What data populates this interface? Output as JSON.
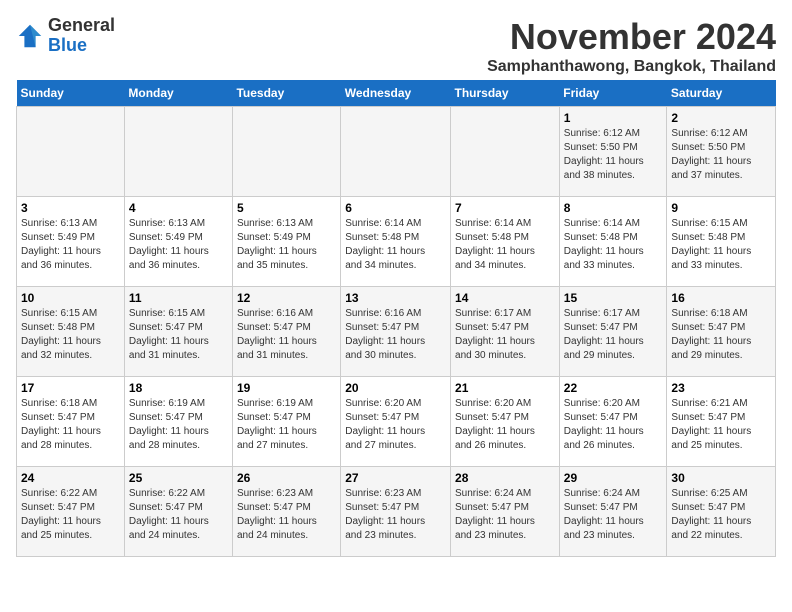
{
  "header": {
    "logo_line1": "General",
    "logo_line2": "Blue",
    "month_title": "November 2024",
    "location": "Samphanthawong, Bangkok, Thailand"
  },
  "weekdays": [
    "Sunday",
    "Monday",
    "Tuesday",
    "Wednesday",
    "Thursday",
    "Friday",
    "Saturday"
  ],
  "weeks": [
    [
      {
        "day": "",
        "info": ""
      },
      {
        "day": "",
        "info": ""
      },
      {
        "day": "",
        "info": ""
      },
      {
        "day": "",
        "info": ""
      },
      {
        "day": "",
        "info": ""
      },
      {
        "day": "1",
        "info": "Sunrise: 6:12 AM\nSunset: 5:50 PM\nDaylight: 11 hours\nand 38 minutes."
      },
      {
        "day": "2",
        "info": "Sunrise: 6:12 AM\nSunset: 5:50 PM\nDaylight: 11 hours\nand 37 minutes."
      }
    ],
    [
      {
        "day": "3",
        "info": "Sunrise: 6:13 AM\nSunset: 5:49 PM\nDaylight: 11 hours\nand 36 minutes."
      },
      {
        "day": "4",
        "info": "Sunrise: 6:13 AM\nSunset: 5:49 PM\nDaylight: 11 hours\nand 36 minutes."
      },
      {
        "day": "5",
        "info": "Sunrise: 6:13 AM\nSunset: 5:49 PM\nDaylight: 11 hours\nand 35 minutes."
      },
      {
        "day": "6",
        "info": "Sunrise: 6:14 AM\nSunset: 5:48 PM\nDaylight: 11 hours\nand 34 minutes."
      },
      {
        "day": "7",
        "info": "Sunrise: 6:14 AM\nSunset: 5:48 PM\nDaylight: 11 hours\nand 34 minutes."
      },
      {
        "day": "8",
        "info": "Sunrise: 6:14 AM\nSunset: 5:48 PM\nDaylight: 11 hours\nand 33 minutes."
      },
      {
        "day": "9",
        "info": "Sunrise: 6:15 AM\nSunset: 5:48 PM\nDaylight: 11 hours\nand 33 minutes."
      }
    ],
    [
      {
        "day": "10",
        "info": "Sunrise: 6:15 AM\nSunset: 5:48 PM\nDaylight: 11 hours\nand 32 minutes."
      },
      {
        "day": "11",
        "info": "Sunrise: 6:15 AM\nSunset: 5:47 PM\nDaylight: 11 hours\nand 31 minutes."
      },
      {
        "day": "12",
        "info": "Sunrise: 6:16 AM\nSunset: 5:47 PM\nDaylight: 11 hours\nand 31 minutes."
      },
      {
        "day": "13",
        "info": "Sunrise: 6:16 AM\nSunset: 5:47 PM\nDaylight: 11 hours\nand 30 minutes."
      },
      {
        "day": "14",
        "info": "Sunrise: 6:17 AM\nSunset: 5:47 PM\nDaylight: 11 hours\nand 30 minutes."
      },
      {
        "day": "15",
        "info": "Sunrise: 6:17 AM\nSunset: 5:47 PM\nDaylight: 11 hours\nand 29 minutes."
      },
      {
        "day": "16",
        "info": "Sunrise: 6:18 AM\nSunset: 5:47 PM\nDaylight: 11 hours\nand 29 minutes."
      }
    ],
    [
      {
        "day": "17",
        "info": "Sunrise: 6:18 AM\nSunset: 5:47 PM\nDaylight: 11 hours\nand 28 minutes."
      },
      {
        "day": "18",
        "info": "Sunrise: 6:19 AM\nSunset: 5:47 PM\nDaylight: 11 hours\nand 28 minutes."
      },
      {
        "day": "19",
        "info": "Sunrise: 6:19 AM\nSunset: 5:47 PM\nDaylight: 11 hours\nand 27 minutes."
      },
      {
        "day": "20",
        "info": "Sunrise: 6:20 AM\nSunset: 5:47 PM\nDaylight: 11 hours\nand 27 minutes."
      },
      {
        "day": "21",
        "info": "Sunrise: 6:20 AM\nSunset: 5:47 PM\nDaylight: 11 hours\nand 26 minutes."
      },
      {
        "day": "22",
        "info": "Sunrise: 6:20 AM\nSunset: 5:47 PM\nDaylight: 11 hours\nand 26 minutes."
      },
      {
        "day": "23",
        "info": "Sunrise: 6:21 AM\nSunset: 5:47 PM\nDaylight: 11 hours\nand 25 minutes."
      }
    ],
    [
      {
        "day": "24",
        "info": "Sunrise: 6:22 AM\nSunset: 5:47 PM\nDaylight: 11 hours\nand 25 minutes."
      },
      {
        "day": "25",
        "info": "Sunrise: 6:22 AM\nSunset: 5:47 PM\nDaylight: 11 hours\nand 24 minutes."
      },
      {
        "day": "26",
        "info": "Sunrise: 6:23 AM\nSunset: 5:47 PM\nDaylight: 11 hours\nand 24 minutes."
      },
      {
        "day": "27",
        "info": "Sunrise: 6:23 AM\nSunset: 5:47 PM\nDaylight: 11 hours\nand 23 minutes."
      },
      {
        "day": "28",
        "info": "Sunrise: 6:24 AM\nSunset: 5:47 PM\nDaylight: 11 hours\nand 23 minutes."
      },
      {
        "day": "29",
        "info": "Sunrise: 6:24 AM\nSunset: 5:47 PM\nDaylight: 11 hours\nand 23 minutes."
      },
      {
        "day": "30",
        "info": "Sunrise: 6:25 AM\nSunset: 5:47 PM\nDaylight: 11 hours\nand 22 minutes."
      }
    ]
  ]
}
